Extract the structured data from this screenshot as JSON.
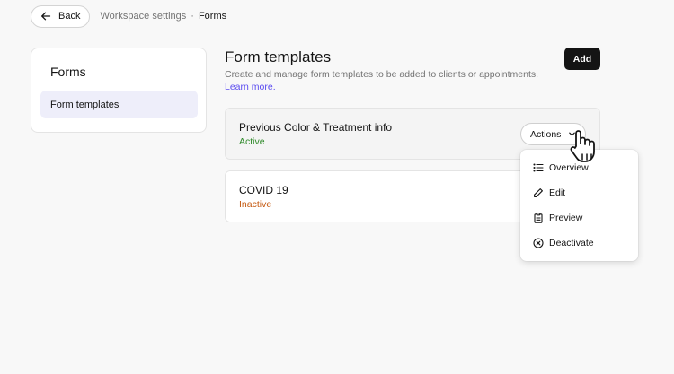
{
  "topbar": {
    "back_label": "Back",
    "breadcrumb": [
      "Workspace settings",
      "Forms"
    ],
    "separator": "·"
  },
  "sidebar": {
    "title": "Forms",
    "items": [
      {
        "label": "Form templates",
        "selected": true
      }
    ]
  },
  "main": {
    "title": "Form templates",
    "description": "Create and manage form templates to be added to clients or appointments.",
    "learn_more": "Learn more.",
    "add_label": "Add"
  },
  "templates": [
    {
      "name": "Previous Color & Treatment info",
      "status": "Active",
      "status_color": "#2f8a2a",
      "actions_label": "Actions"
    },
    {
      "name": "COVID 19",
      "status": "Inactive",
      "status_color": "#c55a11"
    }
  ],
  "actions_menu": [
    {
      "label": "Overview",
      "icon": "list-icon"
    },
    {
      "label": "Edit",
      "icon": "pencil-icon"
    },
    {
      "label": "Preview",
      "icon": "clipboard-icon"
    },
    {
      "label": "Deactivate",
      "icon": "x-circle-icon"
    }
  ],
  "colors": {
    "accent": "#5b4cf0",
    "selected_bg": "#eeeefa",
    "primary_button": "#141414"
  }
}
